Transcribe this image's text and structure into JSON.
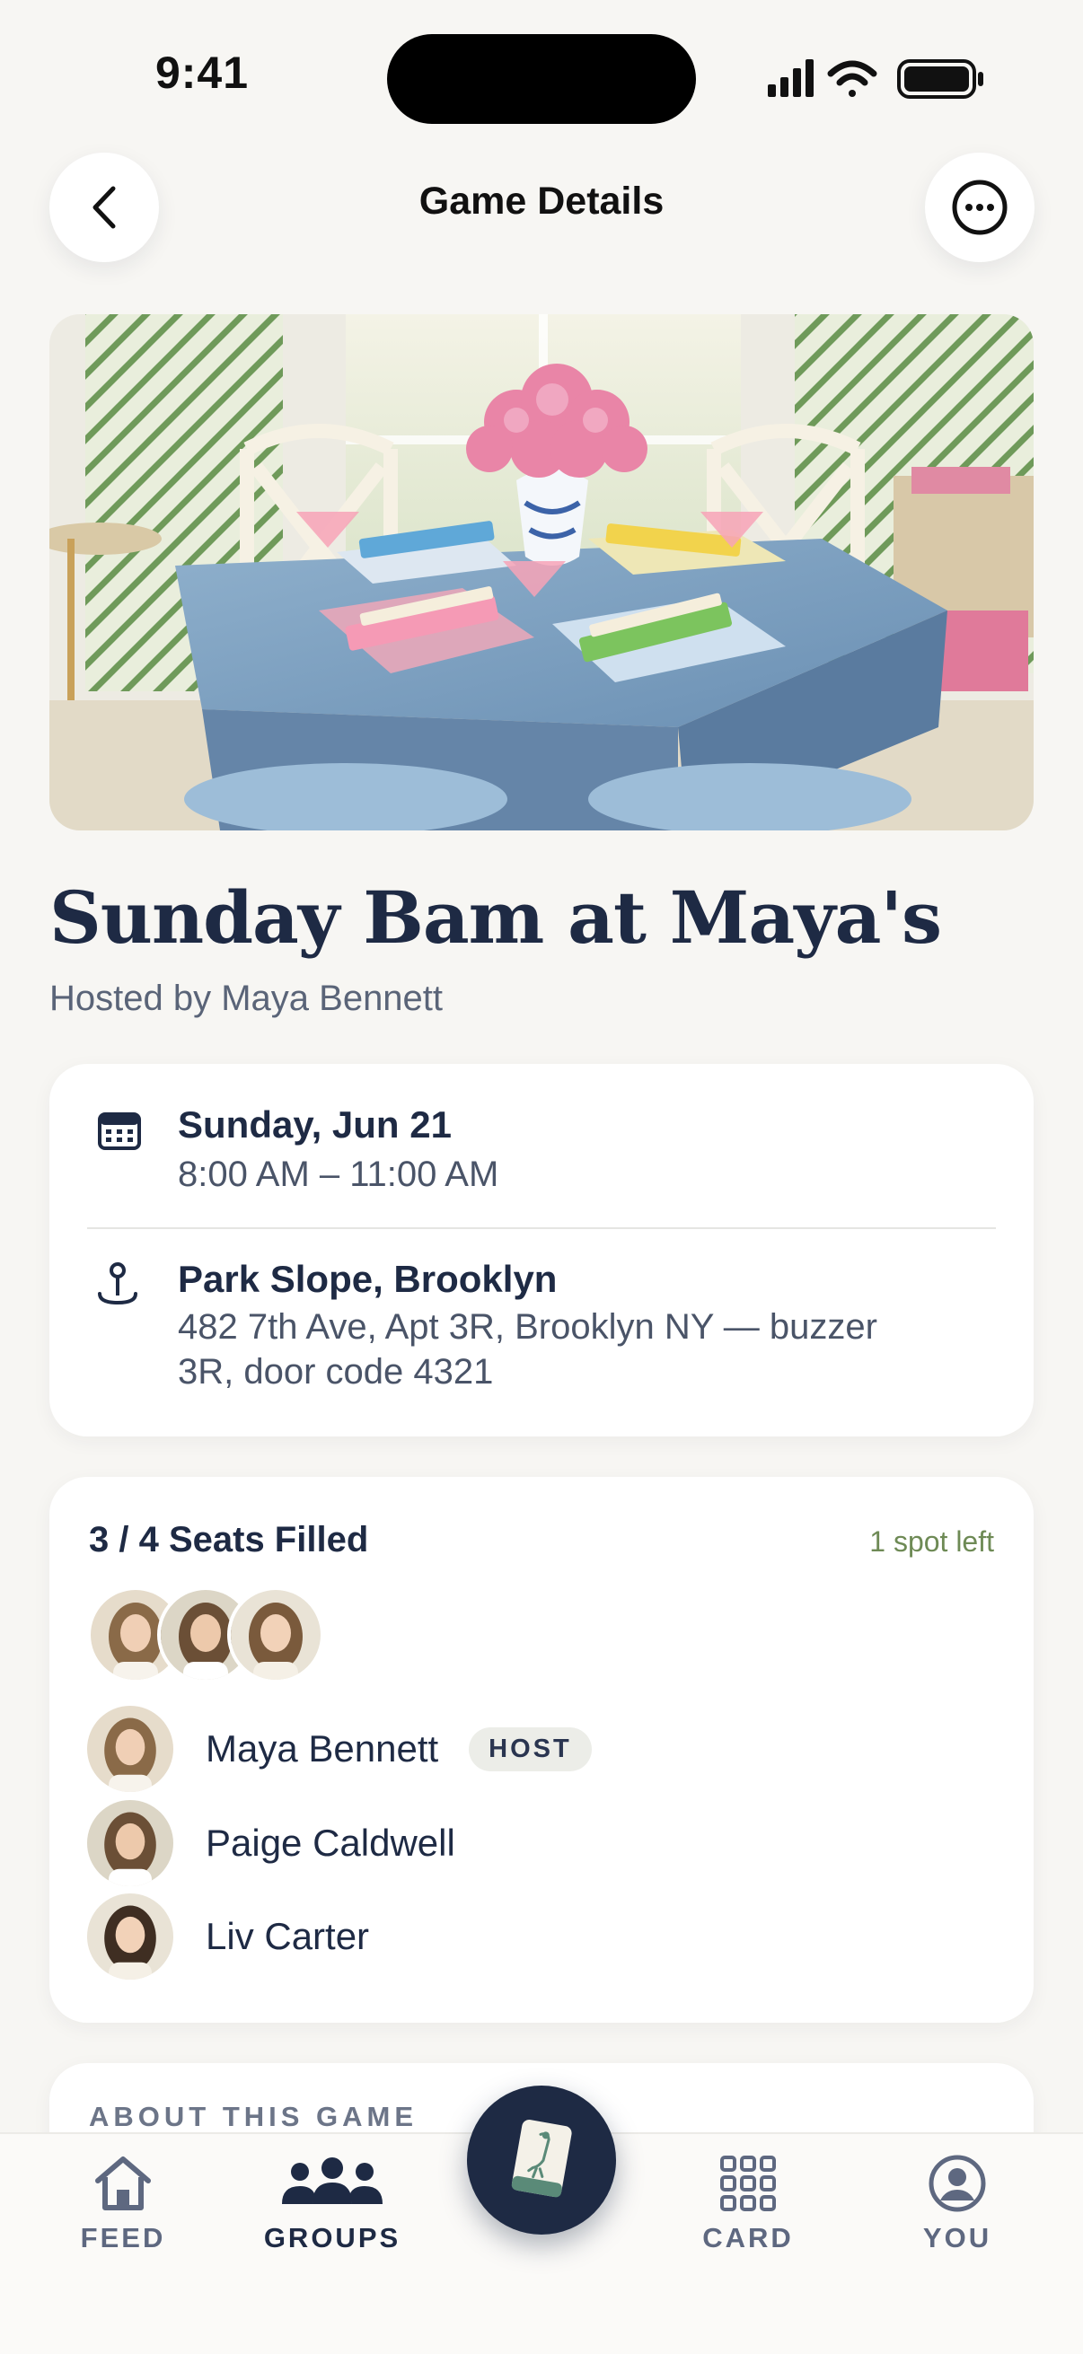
{
  "status_bar": {
    "time": "9:41"
  },
  "header": {
    "title": "Game Details"
  },
  "game": {
    "title": "Sunday Bam at Maya's",
    "hosted_by": "Hosted by Maya Bennett",
    "date": "Sunday, Jun 21",
    "time_range": "8:00 AM – 11:00 AM",
    "location_name": "Park Slope, Brooklyn",
    "address_line1": "482 7th Ave, Apt 3R, Brooklyn NY — buzzer",
    "address_line2": "3R, door code 4321"
  },
  "seats": {
    "title": "3 / 4 Seats Filled",
    "spots_left": "1 spot left",
    "fill_fraction": 0.75,
    "members": [
      {
        "name": "Maya Bennett",
        "badge": "HOST"
      },
      {
        "name": "Paige Caldwell"
      },
      {
        "name": "Liv Carter"
      }
    ]
  },
  "about": {
    "label": "ABOUT THIS GAME"
  },
  "tabbar": {
    "tabs": [
      {
        "label": "FEED",
        "icon": "home-icon"
      },
      {
        "label": "GROUPS",
        "icon": "groups-icon",
        "active": true
      },
      {
        "label": "CARD",
        "icon": "grid-icon"
      },
      {
        "label": "YOU",
        "icon": "profile-icon"
      }
    ],
    "center_icon": "mahjong-tile-icon"
  },
  "colors": {
    "navy": "#1E2A44",
    "background": "#F7F6F3",
    "accent_green": "#6E8A55"
  }
}
